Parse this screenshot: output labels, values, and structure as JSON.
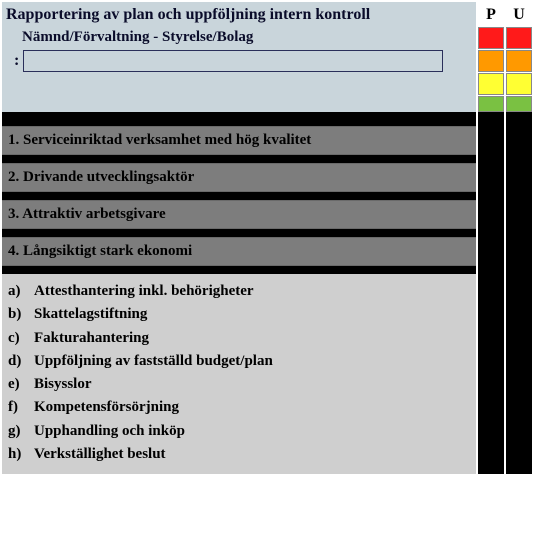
{
  "header": {
    "title": "Rapportering av plan och uppföljning intern kontroll",
    "subtitle": "Nämnd/Förvaltning - Styrelse/Bolag",
    "colon": ":",
    "field_value": "",
    "columns": {
      "p": "P",
      "u": "U"
    }
  },
  "legend": {
    "levels": [
      "red",
      "orange",
      "yellow",
      "green"
    ]
  },
  "categories": [
    {
      "num": "1.",
      "label": "Serviceinriktad verksamhet med hög kvalitet"
    },
    {
      "num": "2.",
      "label": "Drivande utvecklingsaktör"
    },
    {
      "num": "3.",
      "label": "Attraktiv arbetsgivare"
    },
    {
      "num": "4.",
      "label": "Långsiktigt stark ekonomi"
    }
  ],
  "items": [
    {
      "tag": "a)",
      "label": "Attesthantering inkl. behörigheter"
    },
    {
      "tag": "b)",
      "label": "Skattelagstiftning"
    },
    {
      "tag": "c)",
      "label": "Fakturahantering"
    },
    {
      "tag": "d)",
      "label": "Uppföljning av fastställd budget/plan"
    },
    {
      "tag": "e)",
      "label": "Bisysslor"
    },
    {
      "tag": "f)",
      "label": "Kompetensförsörjning"
    },
    {
      "tag": "g)",
      "label": "Upphandling och inköp"
    },
    {
      "tag": "h)",
      "label": "Verkställighet beslut"
    }
  ]
}
